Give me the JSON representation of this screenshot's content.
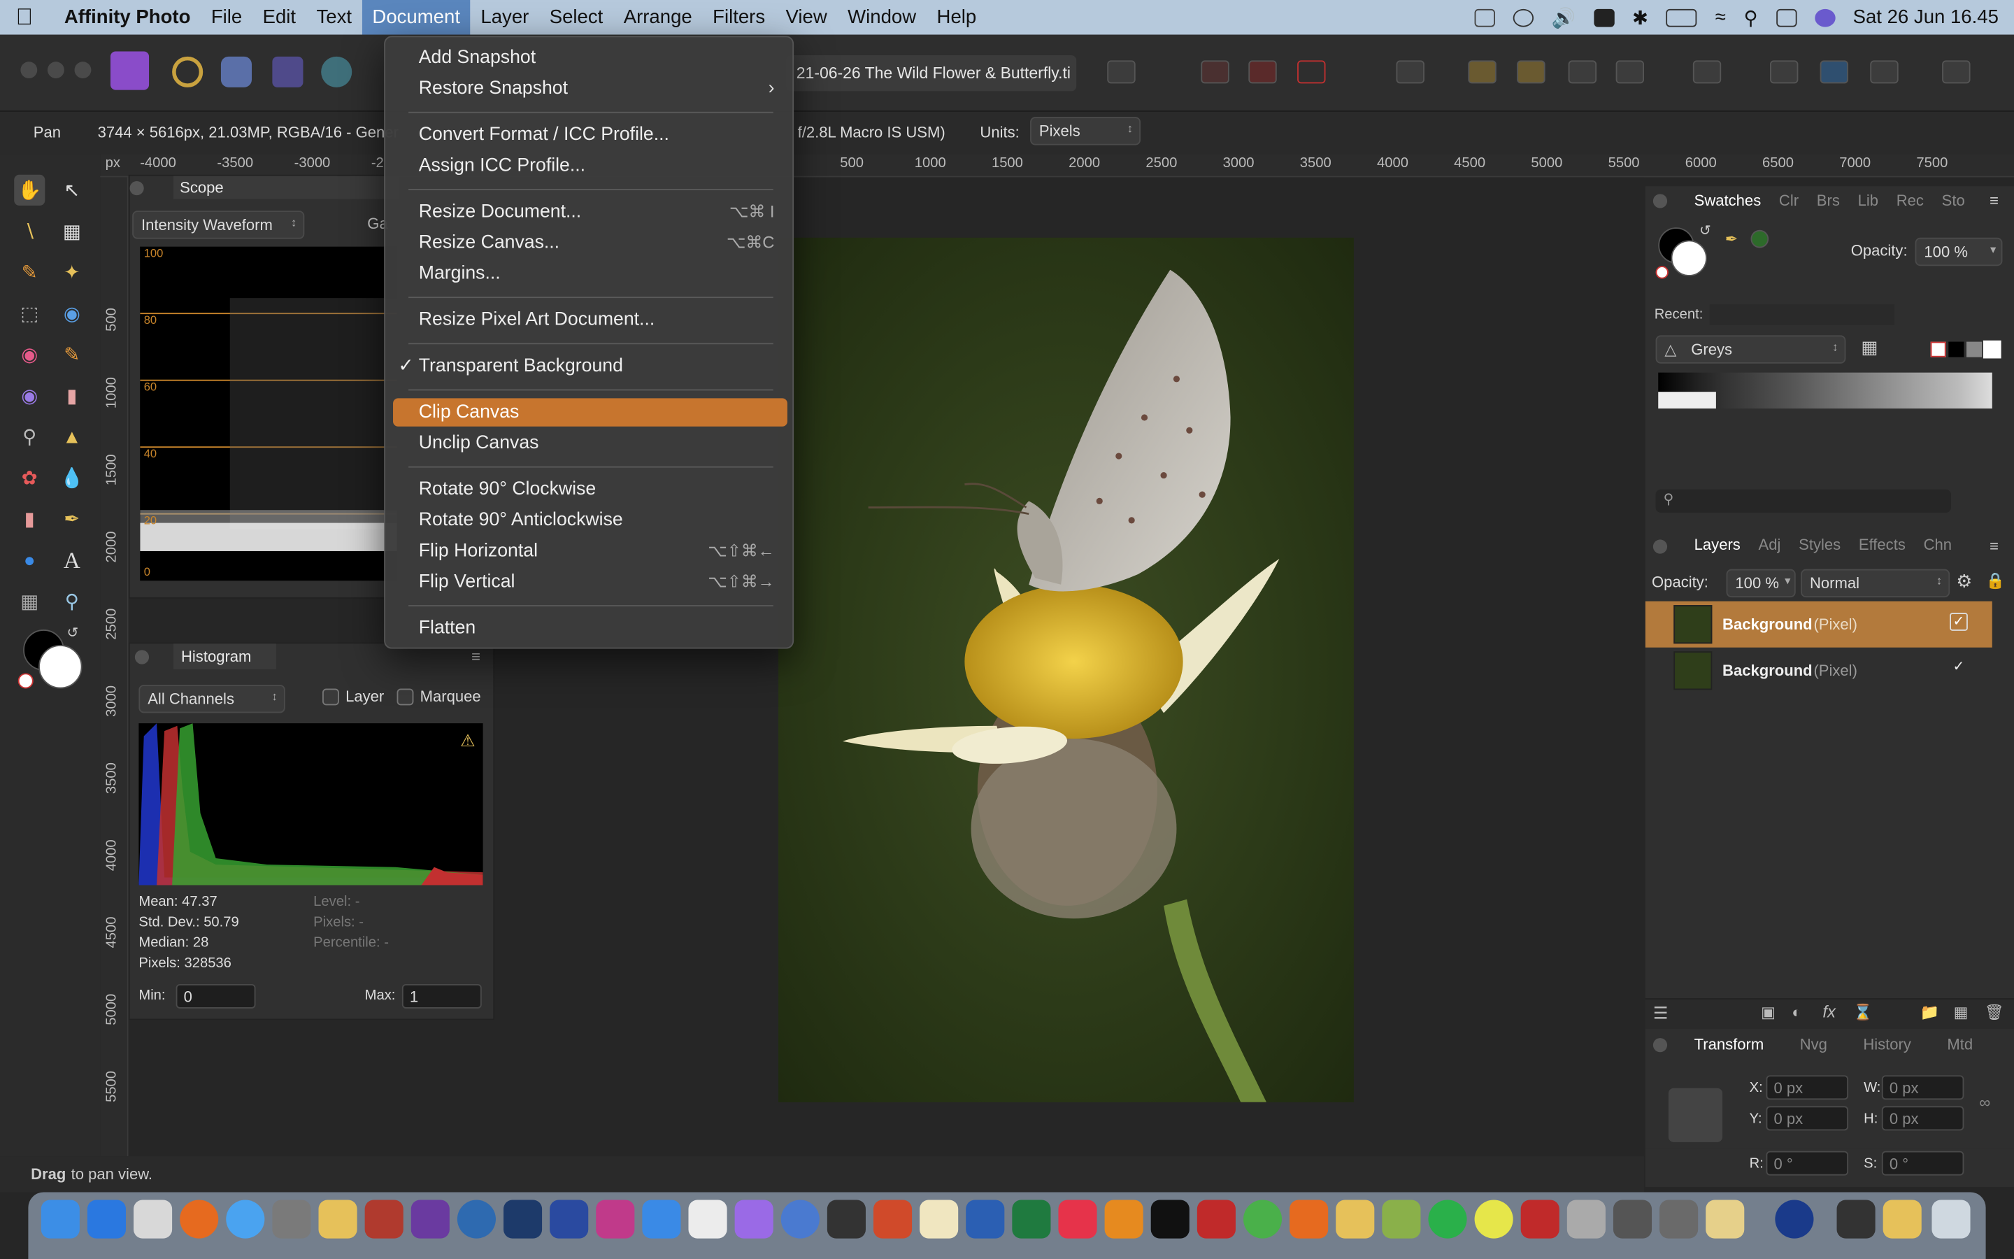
{
  "menubar": {
    "apple": "",
    "app_name": "Affinity Photo",
    "items": [
      "File",
      "Edit",
      "Text",
      "Document",
      "Layer",
      "Select",
      "Arrange",
      "Filters",
      "View",
      "Window",
      "Help"
    ],
    "active": "Document",
    "datetime": "Sat 26 Jun  16.45"
  },
  "toolbar": {
    "doc_tab_title": "21-06-26 The Wild Flower & Butterfly.ti",
    "doc_tab_close": "✕"
  },
  "context": {
    "tool": "Pan",
    "info": "3744 × 5616px, 21.03MP, RGBA/16 - Gener",
    "lens": "f/2.8L Macro IS USM)",
    "units_label": "Units:",
    "units_value": "Pixels"
  },
  "ruler": {
    "unit": "px",
    "top_ticks": [
      "-4000",
      "-3500",
      "-3000",
      "-2",
      "500",
      "1000",
      "1500",
      "2000",
      "2500",
      "3000",
      "3500",
      "4000",
      "4500",
      "5000",
      "5500",
      "6000",
      "6500",
      "7000",
      "7500"
    ],
    "left_ticks": [
      "500",
      "1000",
      "1500",
      "2000",
      "2500",
      "3000",
      "3500",
      "4000",
      "4500",
      "5000",
      "5500"
    ]
  },
  "scope": {
    "tab": "Scope",
    "mode": "Intensity Waveform",
    "extra": "Ga",
    "levels": [
      "100",
      "80",
      "60",
      "40",
      "20",
      "0"
    ]
  },
  "histogram": {
    "tab": "Histogram",
    "channels": "All Channels",
    "layer_label": "Layer",
    "marquee_label": "Marquee",
    "mean": "Mean: 47.37",
    "std": "Std. Dev.: 50.79",
    "median": "Median: 28",
    "pixels": "Pixels: 328536",
    "level": "Level: -",
    "pixels2": "Pixels: -",
    "percentile": "Percentile: -",
    "min_label": "Min:",
    "min_value": "0",
    "max_label": "Max:",
    "max_value": "1"
  },
  "document_menu": {
    "items": [
      {
        "label": "Add Snapshot",
        "shortcut": ""
      },
      {
        "label": "Restore Snapshot",
        "shortcut": "",
        "submenu": true
      },
      {
        "label": "Convert Format / ICC Profile...",
        "shortcut": ""
      },
      {
        "label": "Assign ICC Profile...",
        "shortcut": ""
      },
      {
        "label": "Resize Document...",
        "shortcut": "⌥⌘ I"
      },
      {
        "label": "Resize Canvas...",
        "shortcut": "⌥⌘C"
      },
      {
        "label": "Margins...",
        "shortcut": ""
      },
      {
        "label": "Resize Pixel Art Document...",
        "shortcut": ""
      },
      {
        "label": "Transparent Background",
        "shortcut": "",
        "checked": true
      },
      {
        "label": "Clip Canvas",
        "shortcut": "",
        "highlighted": true
      },
      {
        "label": "Unclip Canvas",
        "shortcut": ""
      },
      {
        "label": "Rotate 90° Clockwise",
        "shortcut": ""
      },
      {
        "label": "Rotate 90° Anticlockwise",
        "shortcut": ""
      },
      {
        "label": "Flip Horizontal",
        "shortcut": "⌥⇧⌘←"
      },
      {
        "label": "Flip Vertical",
        "shortcut": "⌥⇧⌘→"
      },
      {
        "label": "Flatten",
        "shortcut": ""
      }
    ],
    "check_glyph": "✓",
    "submenu_glyph": "›"
  },
  "swatches": {
    "tabs": [
      "Swatches",
      "Clr",
      "Brs",
      "Lib",
      "Rec",
      "Sto"
    ],
    "opacity_label": "Opacity:",
    "opacity_value": "100 %",
    "recent_label": "Recent:",
    "palette": "Greys"
  },
  "layers": {
    "tabs": [
      "Layers",
      "Adj",
      "Styles",
      "Effects",
      "Chn"
    ],
    "opacity_label": "Opacity:",
    "opacity_value": "100 %",
    "blend": "Normal",
    "rows": [
      {
        "name": "Background",
        "type": "(Pixel)",
        "selected": true,
        "check": "✓"
      },
      {
        "name": "Background",
        "type": "(Pixel)",
        "selected": false,
        "check": "✓"
      }
    ]
  },
  "transform": {
    "tabs": [
      "Transform",
      "Nvg",
      "History",
      "Mtd"
    ],
    "x_label": "X:",
    "x_value": "0 px",
    "y_label": "Y:",
    "y_value": "0 px",
    "w_label": "W:",
    "w_value": "0 px",
    "h_label": "H:",
    "h_value": "0 px",
    "r_label": "R:",
    "r_value": "0 °",
    "s_label": "S:",
    "s_value": "0 °"
  },
  "statusbar": {
    "bold": "Drag",
    "text": " to pan view."
  },
  "colors": {
    "menu_highlight": "#c7752e",
    "menubar_bg": "#b6c9dc",
    "selected_layer": "#b37a3c"
  }
}
